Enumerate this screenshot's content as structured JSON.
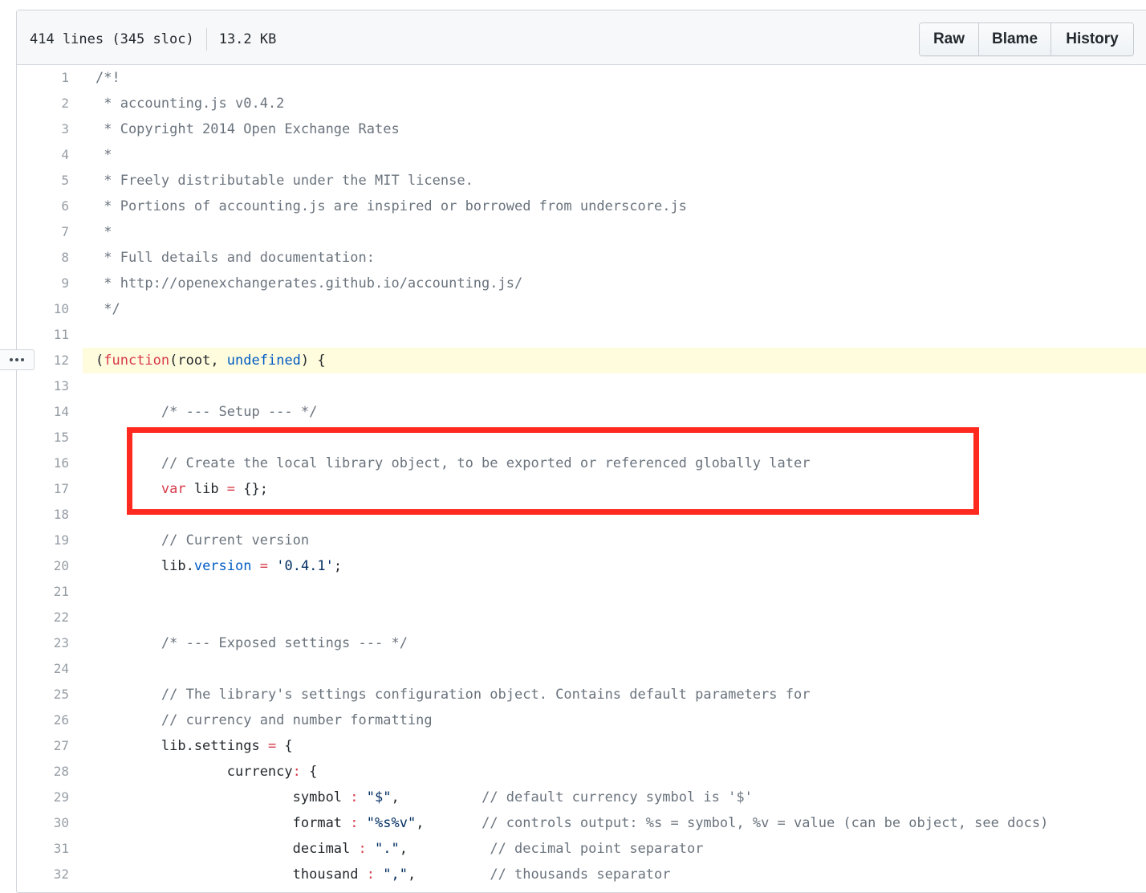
{
  "file_header": {
    "lines": "414 lines (345 sloc)",
    "size": "13.2 KB",
    "buttons": {
      "raw": "Raw",
      "blame": "Blame",
      "history": "History"
    }
  },
  "highlighted_line": 12,
  "annotation": {
    "color": "#ff2a1f",
    "covers_lines": [
      16,
      17
    ]
  },
  "colors": {
    "comment": "#6a737d",
    "keyword": "#d73a49",
    "constant": "#005cc5",
    "string": "#032f62",
    "text": "#24292e",
    "line_number": "#959da5",
    "highlight_bg": "#fffbdd"
  },
  "code_lines": [
    {
      "n": "1",
      "tokens": [
        {
          "t": "c",
          "v": "/*!"
        }
      ]
    },
    {
      "n": "2",
      "tokens": [
        {
          "t": "c",
          "v": " * accounting.js v0.4.2"
        }
      ]
    },
    {
      "n": "3",
      "tokens": [
        {
          "t": "c",
          "v": " * Copyright 2014 Open Exchange Rates"
        }
      ]
    },
    {
      "n": "4",
      "tokens": [
        {
          "t": "c",
          "v": " *"
        }
      ]
    },
    {
      "n": "5",
      "tokens": [
        {
          "t": "c",
          "v": " * Freely distributable under the MIT license."
        }
      ]
    },
    {
      "n": "6",
      "tokens": [
        {
          "t": "c",
          "v": " * Portions of accounting.js are inspired or borrowed from underscore.js"
        }
      ]
    },
    {
      "n": "7",
      "tokens": [
        {
          "t": "c",
          "v": " *"
        }
      ]
    },
    {
      "n": "8",
      "tokens": [
        {
          "t": "c",
          "v": " * Full details and documentation:"
        }
      ]
    },
    {
      "n": "9",
      "tokens": [
        {
          "t": "c",
          "v": " * http://openexchangerates.github.io/accounting.js/"
        }
      ]
    },
    {
      "n": "10",
      "tokens": [
        {
          "t": "c",
          "v": " */"
        }
      ]
    },
    {
      "n": "11",
      "tokens": []
    },
    {
      "n": "12",
      "tokens": [
        {
          "t": "p",
          "v": "("
        },
        {
          "t": "k",
          "v": "function"
        },
        {
          "t": "p",
          "v": "(root, "
        },
        {
          "t": "x",
          "v": "undefined"
        },
        {
          "t": "p",
          "v": ") {"
        }
      ]
    },
    {
      "n": "13",
      "tokens": []
    },
    {
      "n": "14",
      "tokens": [
        {
          "t": "p",
          "v": "        "
        },
        {
          "t": "c",
          "v": "/* --- Setup --- */"
        }
      ]
    },
    {
      "n": "15",
      "tokens": []
    },
    {
      "n": "16",
      "tokens": [
        {
          "t": "p",
          "v": "        "
        },
        {
          "t": "c",
          "v": "// Create the local library object, to be exported or referenced globally later"
        }
      ]
    },
    {
      "n": "17",
      "tokens": [
        {
          "t": "p",
          "v": "        "
        },
        {
          "t": "k",
          "v": "var"
        },
        {
          "t": "p",
          "v": " lib "
        },
        {
          "t": "k",
          "v": "="
        },
        {
          "t": "p",
          "v": " {};"
        }
      ]
    },
    {
      "n": "18",
      "tokens": []
    },
    {
      "n": "19",
      "tokens": [
        {
          "t": "p",
          "v": "        "
        },
        {
          "t": "c",
          "v": "// Current version"
        }
      ]
    },
    {
      "n": "20",
      "tokens": [
        {
          "t": "p",
          "v": "        lib."
        },
        {
          "t": "x",
          "v": "version"
        },
        {
          "t": "p",
          "v": " "
        },
        {
          "t": "k",
          "v": "="
        },
        {
          "t": "p",
          "v": " "
        },
        {
          "t": "s",
          "v": "'0.4.1'"
        },
        {
          "t": "p",
          "v": ";"
        }
      ]
    },
    {
      "n": "21",
      "tokens": []
    },
    {
      "n": "22",
      "tokens": []
    },
    {
      "n": "23",
      "tokens": [
        {
          "t": "p",
          "v": "        "
        },
        {
          "t": "c",
          "v": "/* --- Exposed settings --- */"
        }
      ]
    },
    {
      "n": "24",
      "tokens": []
    },
    {
      "n": "25",
      "tokens": [
        {
          "t": "p",
          "v": "        "
        },
        {
          "t": "c",
          "v": "// The library's settings configuration object. Contains default parameters for"
        }
      ]
    },
    {
      "n": "26",
      "tokens": [
        {
          "t": "p",
          "v": "        "
        },
        {
          "t": "c",
          "v": "// currency and number formatting"
        }
      ]
    },
    {
      "n": "27",
      "tokens": [
        {
          "t": "p",
          "v": "        lib.settings "
        },
        {
          "t": "k",
          "v": "="
        },
        {
          "t": "p",
          "v": " {"
        }
      ]
    },
    {
      "n": "28",
      "tokens": [
        {
          "t": "p",
          "v": "                currency"
        },
        {
          "t": "k",
          "v": ":"
        },
        {
          "t": "p",
          "v": " {"
        }
      ]
    },
    {
      "n": "29",
      "tokens": [
        {
          "t": "p",
          "v": "                        symbol "
        },
        {
          "t": "k",
          "v": ":"
        },
        {
          "t": "p",
          "v": " "
        },
        {
          "t": "s",
          "v": "\"$\""
        },
        {
          "t": "p",
          "v": ",          "
        },
        {
          "t": "c",
          "v": "// default currency symbol is '$'"
        }
      ]
    },
    {
      "n": "30",
      "tokens": [
        {
          "t": "p",
          "v": "                        format "
        },
        {
          "t": "k",
          "v": ":"
        },
        {
          "t": "p",
          "v": " "
        },
        {
          "t": "s",
          "v": "\"%s%v\""
        },
        {
          "t": "p",
          "v": ",       "
        },
        {
          "t": "c",
          "v": "// controls output: %s = symbol, %v = value (can be object, see docs)"
        }
      ]
    },
    {
      "n": "31",
      "tokens": [
        {
          "t": "p",
          "v": "                        decimal "
        },
        {
          "t": "k",
          "v": ":"
        },
        {
          "t": "p",
          "v": " "
        },
        {
          "t": "s",
          "v": "\".\""
        },
        {
          "t": "p",
          "v": ",          "
        },
        {
          "t": "c",
          "v": "// decimal point separator"
        }
      ]
    },
    {
      "n": "32",
      "tokens": [
        {
          "t": "p",
          "v": "                        thousand "
        },
        {
          "t": "k",
          "v": ":"
        },
        {
          "t": "p",
          "v": " "
        },
        {
          "t": "s",
          "v": "\",\""
        },
        {
          "t": "p",
          "v": ",         "
        },
        {
          "t": "c",
          "v": "// thousands separator"
        }
      ]
    }
  ]
}
